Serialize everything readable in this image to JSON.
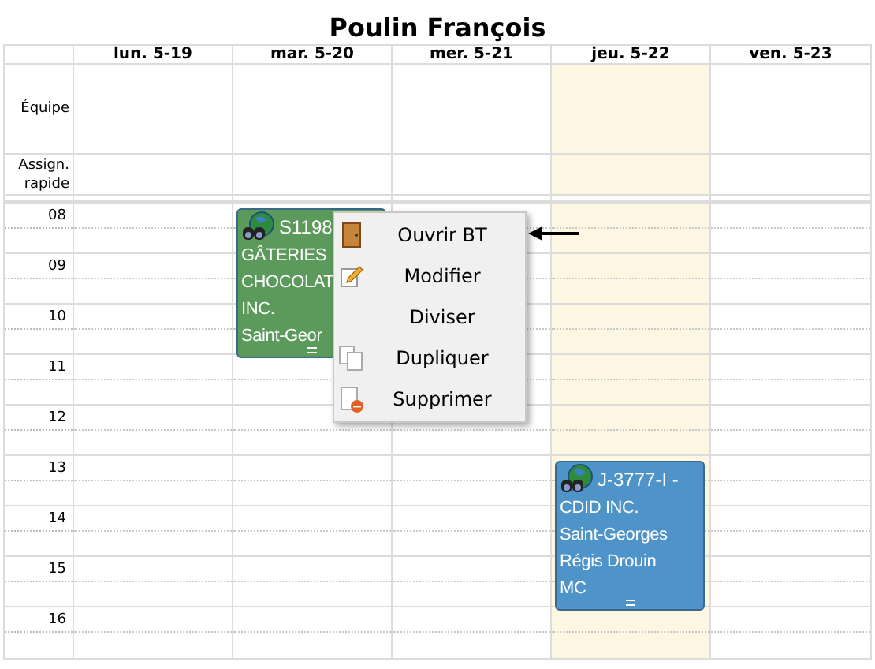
{
  "title": "Poulin François",
  "days": [
    {
      "label": "lun. 5-19",
      "today": false
    },
    {
      "label": "mar. 5-20",
      "today": false
    },
    {
      "label": "mer. 5-21",
      "today": false
    },
    {
      "label": "jeu. 5-22",
      "today": true
    },
    {
      "label": "ven. 5-23",
      "today": false
    }
  ],
  "rows": [
    "Équipe",
    "Assign. rapide"
  ],
  "hours": [
    "08",
    "09",
    "10",
    "11",
    "12",
    "13",
    "14",
    "15",
    "16"
  ],
  "events": [
    {
      "color": "#5c9a5c",
      "lines": [
        "S1198",
        "GÂTERIES",
        "CHOCOLAT",
        "INC.",
        "Saint-Geor"
      ]
    },
    {
      "color": "#4f94c9",
      "lines": [
        "J-3777-I -",
        "CDID INC.",
        "Saint-Georges",
        "Régis Drouin",
        "MC"
      ]
    }
  ],
  "context_menu": [
    {
      "label": "Ouvrir BT"
    },
    {
      "label": "Modifier"
    },
    {
      "label": "Diviser"
    },
    {
      "label": "Dupliquer"
    },
    {
      "label": "Supprimer"
    }
  ]
}
